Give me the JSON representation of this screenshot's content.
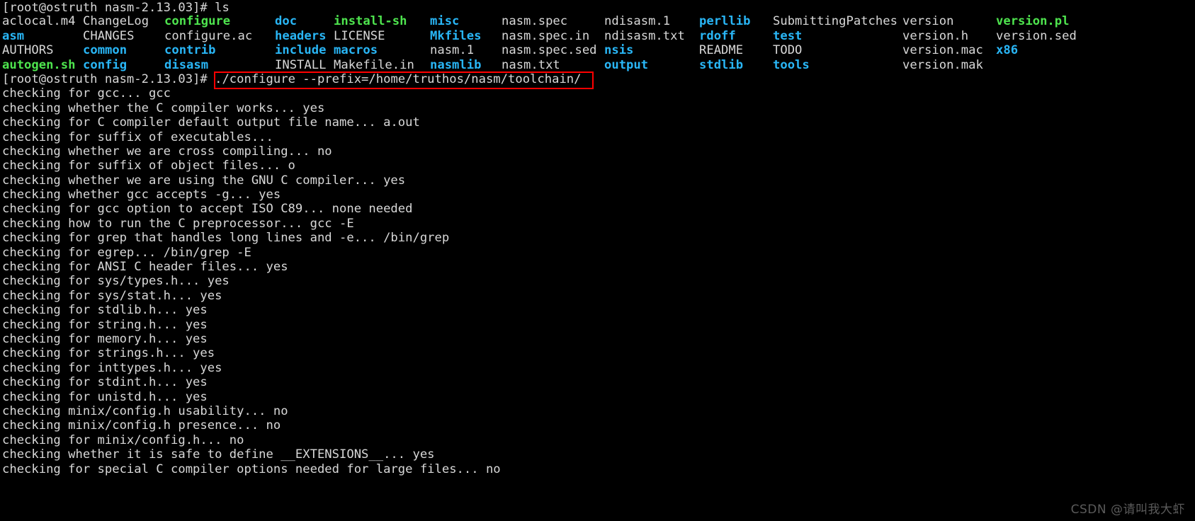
{
  "terminal": {
    "theme": {
      "background": "#000000",
      "foreground": "#d8d8d8",
      "directory_color": "#29b6f6",
      "executable_color": "#4ee44e",
      "highlight_box_color": "#ff0000"
    },
    "prompt": "[root@ostruth nasm-2.13.03]# ",
    "commands": {
      "ls": "ls",
      "configure": "./configure --prefix=/home/truthos/nasm/toolchain/"
    },
    "ls_output": {
      "columns": [
        [
          {
            "name": "aclocal.m4",
            "type": "file"
          },
          {
            "name": "asm",
            "type": "dir"
          },
          {
            "name": "AUTHORS",
            "type": "file"
          },
          {
            "name": "autogen.sh",
            "type": "exec"
          }
        ],
        [
          {
            "name": "ChangeLog",
            "type": "file"
          },
          {
            "name": "CHANGES",
            "type": "file"
          },
          {
            "name": "common",
            "type": "dir"
          },
          {
            "name": "config",
            "type": "dir"
          }
        ],
        [
          {
            "name": "configure",
            "type": "exec"
          },
          {
            "name": "configure.ac",
            "type": "file"
          },
          {
            "name": "contrib",
            "type": "dir"
          },
          {
            "name": "disasm",
            "type": "dir"
          }
        ],
        [
          {
            "name": "doc",
            "type": "dir"
          },
          {
            "name": "headers",
            "type": "dir"
          },
          {
            "name": "include",
            "type": "dir"
          },
          {
            "name": "INSTALL",
            "type": "file"
          }
        ],
        [
          {
            "name": "install-sh",
            "type": "exec"
          },
          {
            "name": "LICENSE",
            "type": "file"
          },
          {
            "name": "macros",
            "type": "dir"
          },
          {
            "name": "Makefile.in",
            "type": "file"
          }
        ],
        [
          {
            "name": "misc",
            "type": "dir"
          },
          {
            "name": "Mkfiles",
            "type": "dir"
          },
          {
            "name": "nasm.1",
            "type": "file"
          },
          {
            "name": "nasmlib",
            "type": "dir"
          }
        ],
        [
          {
            "name": "nasm.spec",
            "type": "file"
          },
          {
            "name": "nasm.spec.in",
            "type": "file"
          },
          {
            "name": "nasm.spec.sed",
            "type": "file"
          },
          {
            "name": "nasm.txt",
            "type": "file"
          }
        ],
        [
          {
            "name": "ndisasm.1",
            "type": "file"
          },
          {
            "name": "ndisasm.txt",
            "type": "file"
          },
          {
            "name": "nsis",
            "type": "dir"
          },
          {
            "name": "output",
            "type": "dir"
          }
        ],
        [
          {
            "name": "perllib",
            "type": "dir"
          },
          {
            "name": "rdoff",
            "type": "dir"
          },
          {
            "name": "README",
            "type": "file"
          },
          {
            "name": "stdlib",
            "type": "dir"
          }
        ],
        [
          {
            "name": "SubmittingPatches",
            "type": "file"
          },
          {
            "name": "test",
            "type": "dir"
          },
          {
            "name": "TODO",
            "type": "file"
          },
          {
            "name": "tools",
            "type": "dir"
          }
        ],
        [
          {
            "name": "version",
            "type": "file"
          },
          {
            "name": "version.h",
            "type": "file"
          },
          {
            "name": "version.mac",
            "type": "file"
          },
          {
            "name": "version.mak",
            "type": "file"
          }
        ],
        [
          {
            "name": "version.pl",
            "type": "exec"
          },
          {
            "name": "version.sed",
            "type": "file"
          },
          {
            "name": "x86",
            "type": "dir"
          },
          {
            "name": "",
            "type": "file"
          }
        ]
      ]
    },
    "configure_output": [
      "checking for gcc... gcc",
      "checking whether the C compiler works... yes",
      "checking for C compiler default output file name... a.out",
      "checking for suffix of executables... ",
      "checking whether we are cross compiling... no",
      "checking for suffix of object files... o",
      "checking whether we are using the GNU C compiler... yes",
      "checking whether gcc accepts -g... yes",
      "checking for gcc option to accept ISO C89... none needed",
      "checking how to run the C preprocessor... gcc -E",
      "checking for grep that handles long lines and -e... /bin/grep",
      "checking for egrep... /bin/grep -E",
      "checking for ANSI C header files... yes",
      "checking for sys/types.h... yes",
      "checking for sys/stat.h... yes",
      "checking for stdlib.h... yes",
      "checking for string.h... yes",
      "checking for memory.h... yes",
      "checking for strings.h... yes",
      "checking for inttypes.h... yes",
      "checking for stdint.h... yes",
      "checking for unistd.h... yes",
      "checking minix/config.h usability... no",
      "checking minix/config.h presence... no",
      "checking for minix/config.h... no",
      "checking whether it is safe to define __EXTENSIONS__... yes",
      "checking for special C compiler options needed for large files... no"
    ]
  },
  "watermark": {
    "text": "CSDN @请叫我大虾"
  }
}
